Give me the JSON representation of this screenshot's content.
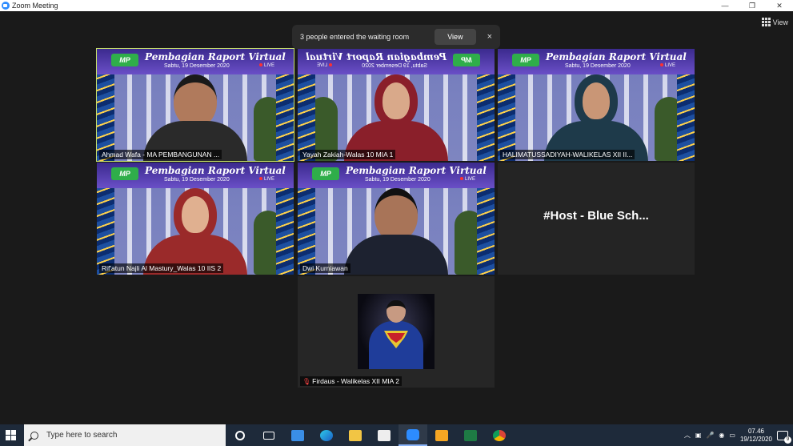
{
  "window": {
    "title": "Zoom Meeting",
    "minimize": "—",
    "maximize": "❐",
    "close": "✕"
  },
  "toolbar": {
    "view_label": "View"
  },
  "notification": {
    "message": "3 people entered the waiting room",
    "button": "View",
    "close": "×"
  },
  "banner": {
    "title": "Pembagian Raport Virtual",
    "date": "Sabtu, 19 Desember 2020",
    "live": "LIVE",
    "logo": "MP"
  },
  "participants": [
    {
      "name": "Ahmad Wafa - MA PEMBANGUNAN ...",
      "active_speaker": true
    },
    {
      "name": "Yayah Zakiah-Walas 10 MIA 1"
    },
    {
      "name": "HALIMATUSSADIYAH-WALIKELAS XII II..."
    },
    {
      "name": "Rif'atun Najli Al Mastury_Walas 10 IIS 2"
    },
    {
      "name": "Dwi Kurniawan"
    },
    {
      "name": "#Host - Blue Sch..."
    },
    {
      "name": "Firdaus - Walikelas XII MIA 2",
      "muted": true
    }
  ],
  "taskbar": {
    "search_placeholder": "Type here to search",
    "time": "07.46",
    "date": "19/12/2020",
    "notification_count": "9"
  },
  "colors": {
    "active_speaker_border": "#c9e36b",
    "zoom_blue": "#2d8cff"
  }
}
